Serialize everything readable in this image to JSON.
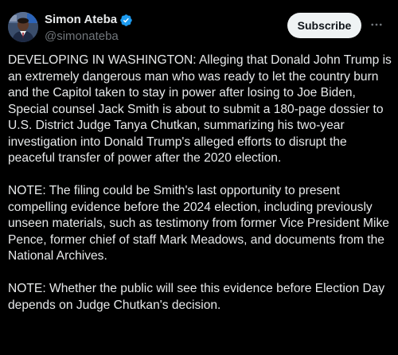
{
  "post": {
    "author": {
      "display_name": "Simon Ateba",
      "handle": "@simonateba",
      "verified_icon": "verified-badge-icon",
      "avatar_icon": "profile-avatar"
    },
    "subscribe_label": "Subscribe",
    "more_icon": "more-options-icon",
    "paragraphs": [
      "DEVELOPING IN WASHINGTON: Alleging that Donald John Trump is an extremely dangerous man who was ready to let the country burn and the Capitol taken to stay in power after losing to Joe Biden, Special counsel Jack Smith is about to submit a 180-page dossier to U.S. District Judge Tanya Chutkan, summarizing his two-year investigation into Donald Trump's alleged efforts to disrupt the peaceful transfer of power after the 2020 election.",
      "NOTE: The filing could be Smith's last opportunity to present compelling evidence before the 2024 election, including previously unseen materials, such as testimony from former Vice President Mike Pence, former chief of staff Mark Meadows, and documents from the National Archives.",
      "NOTE: Whether the public will see this evidence before Election Day depends on Judge Chutkan's decision."
    ]
  },
  "colors": {
    "background": "#000000",
    "text_primary": "#e7e9ea",
    "text_secondary": "#71767b",
    "verified_blue": "#1d9bf0",
    "button_bg": "#eff3f4"
  }
}
